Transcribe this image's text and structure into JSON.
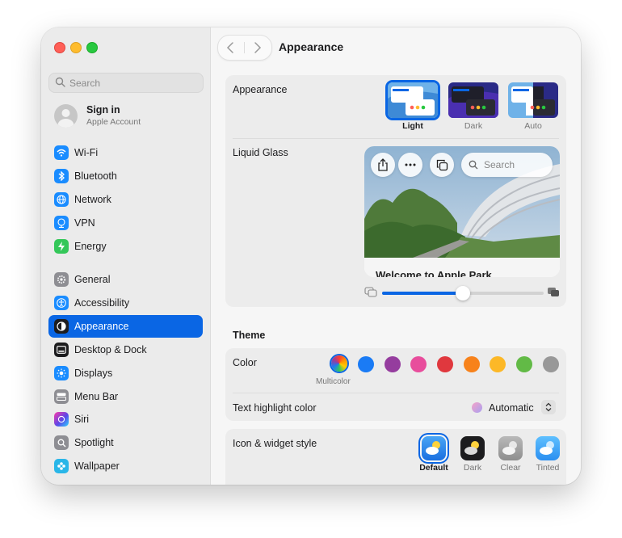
{
  "window": {
    "title": "Appearance"
  },
  "sidebar": {
    "search_placeholder": "Search",
    "account": {
      "title": "Sign in",
      "subtitle": "Apple Account"
    },
    "items": [
      {
        "label": "Wi-Fi",
        "icon": "wifi-icon",
        "color": "#1a8cff"
      },
      {
        "label": "Bluetooth",
        "icon": "bluetooth-icon",
        "color": "#1a8cff"
      },
      {
        "label": "Network",
        "icon": "globe-icon",
        "color": "#1a8cff"
      },
      {
        "label": "VPN",
        "icon": "vpn-icon",
        "color": "#1a8cff"
      },
      {
        "label": "Energy",
        "icon": "bolt-icon",
        "color": "#34c759"
      },
      {
        "label": "General",
        "icon": "gear-icon",
        "color": "#8e8e93"
      },
      {
        "label": "Accessibility",
        "icon": "accessibility-icon",
        "color": "#1a8cff"
      },
      {
        "label": "Appearance",
        "icon": "appearance-icon",
        "color": "#1d1d1f",
        "selected": true
      },
      {
        "label": "Desktop & Dock",
        "icon": "dock-icon",
        "color": "#1d1d1f"
      },
      {
        "label": "Displays",
        "icon": "sun-icon",
        "color": "#1a8cff"
      },
      {
        "label": "Menu Bar",
        "icon": "menubar-icon",
        "color": "#8e8e93"
      },
      {
        "label": "Siri",
        "icon": "siri-icon",
        "color": "#7b3fe4"
      },
      {
        "label": "Spotlight",
        "icon": "spotlight-icon",
        "color": "#8e8e93"
      },
      {
        "label": "Wallpaper",
        "icon": "wallpaper-icon",
        "color": "#29b6e8"
      }
    ]
  },
  "appearance": {
    "label": "Appearance",
    "options": [
      {
        "label": "Light",
        "selected": true
      },
      {
        "label": "Dark",
        "selected": false
      },
      {
        "label": "Auto",
        "selected": false
      }
    ]
  },
  "liquid_glass": {
    "label": "Liquid Glass",
    "search_placeholder": "Search",
    "preview_heading": "Welcome to Apple Park",
    "slider_value": 0.5
  },
  "theme": {
    "title": "Theme",
    "color_label": "Color",
    "selected_color": "Multicolor",
    "colors": [
      {
        "name": "Multicolor",
        "hex": "conic"
      },
      {
        "name": "Blue",
        "hex": "#1a7bf5"
      },
      {
        "name": "Purple",
        "hex": "#953d9e"
      },
      {
        "name": "Pink",
        "hex": "#e84d9c"
      },
      {
        "name": "Red",
        "hex": "#e0383e"
      },
      {
        "name": "Orange",
        "hex": "#f7821b"
      },
      {
        "name": "Yellow",
        "hex": "#fcb827"
      },
      {
        "name": "Green",
        "hex": "#62ba46"
      },
      {
        "name": "Graphite",
        "hex": "#989898"
      }
    ],
    "highlight_label": "Text highlight color",
    "highlight_value": "Automatic"
  },
  "icon_widget": {
    "label": "Icon & widget style",
    "options": [
      {
        "label": "Default",
        "selected": true
      },
      {
        "label": "Dark",
        "selected": false
      },
      {
        "label": "Clear",
        "selected": false
      },
      {
        "label": "Tinted",
        "selected": false
      }
    ]
  }
}
